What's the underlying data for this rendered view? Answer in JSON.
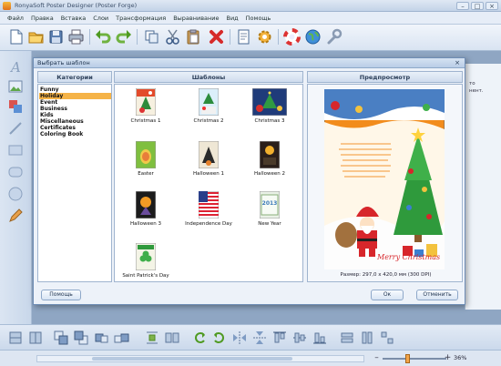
{
  "window": {
    "title": "RonyaSoft Poster Designer (Poster Forge)",
    "minimize": "–",
    "maximize": "□",
    "close": "×"
  },
  "menu": [
    "Файл",
    "Правка",
    "Вставка",
    "Слои",
    "Трансформация",
    "Выравнивание",
    "Вид",
    "Помощь"
  ],
  "toolbar_icons": [
    "new-document",
    "open-folder",
    "save",
    "print",
    "undo",
    "redo",
    "copy",
    "cut",
    "paste",
    "delete",
    "properties",
    "settings",
    "help-lifebuoy",
    "web-globe",
    "tools-wrench"
  ],
  "left_tools": [
    "text-tool",
    "image-tool",
    "layers-tool",
    "line-tool",
    "rectangle-tool",
    "rounded-rectangle-tool",
    "ellipse-tool",
    "pencil-tool"
  ],
  "right_panel_text": [
    "то",
    "нент."
  ],
  "dialog": {
    "title": "Выбрать шаблон",
    "close": "×",
    "categories_header": "Категории",
    "templates_header": "Шаблоны",
    "preview_header": "Предпросмотр",
    "categories": [
      {
        "label": "Funny",
        "selected": false
      },
      {
        "label": "Holiday",
        "selected": true
      },
      {
        "label": "Event",
        "selected": false
      },
      {
        "label": "Business",
        "selected": false
      },
      {
        "label": "Kids",
        "selected": false
      },
      {
        "label": "Miscellaneous",
        "selected": false
      },
      {
        "label": "Certificates",
        "selected": false
      },
      {
        "label": "Coloring Book",
        "selected": false
      }
    ],
    "templates": [
      {
        "label": "Christmas 1"
      },
      {
        "label": "Christmas 2"
      },
      {
        "label": "Christmas 3"
      },
      {
        "label": "Easter"
      },
      {
        "label": "Halloween 1"
      },
      {
        "label": "Halloween 2"
      },
      {
        "label": "Halloween 3"
      },
      {
        "label": "Independence Day"
      },
      {
        "label": "New Year"
      },
      {
        "label": "Saint Patrick's Day"
      }
    ],
    "preview": {
      "poster_text": "Merry Christmas",
      "size_text": "Размер: 297,0 x 420,0 мм (300 DPI)",
      "new_year_thumb_text": "2013"
    },
    "help_button": "Помощь",
    "ok_button": "Ок",
    "cancel_button": "Отменить"
  },
  "bottom_icons": [
    "align-left",
    "align-center",
    "bring-front",
    "send-back",
    "bring-forward",
    "send-backward",
    "distribute",
    "group",
    "rotate-left",
    "rotate-right",
    "flip-horizontal",
    "flip-vertical",
    "align-top",
    "align-middle",
    "align-bottom",
    "same-width",
    "same-height",
    "same-size"
  ],
  "status": {
    "zoom": "36%",
    "zoom_out": "–",
    "zoom_in": "+",
    "zoom_level": 0.4
  },
  "colors": {
    "accent": "#f5b347",
    "dialog_border": "#6e8db5",
    "poster_orange": "#f28c1c",
    "poster_red": "#d7262b"
  }
}
